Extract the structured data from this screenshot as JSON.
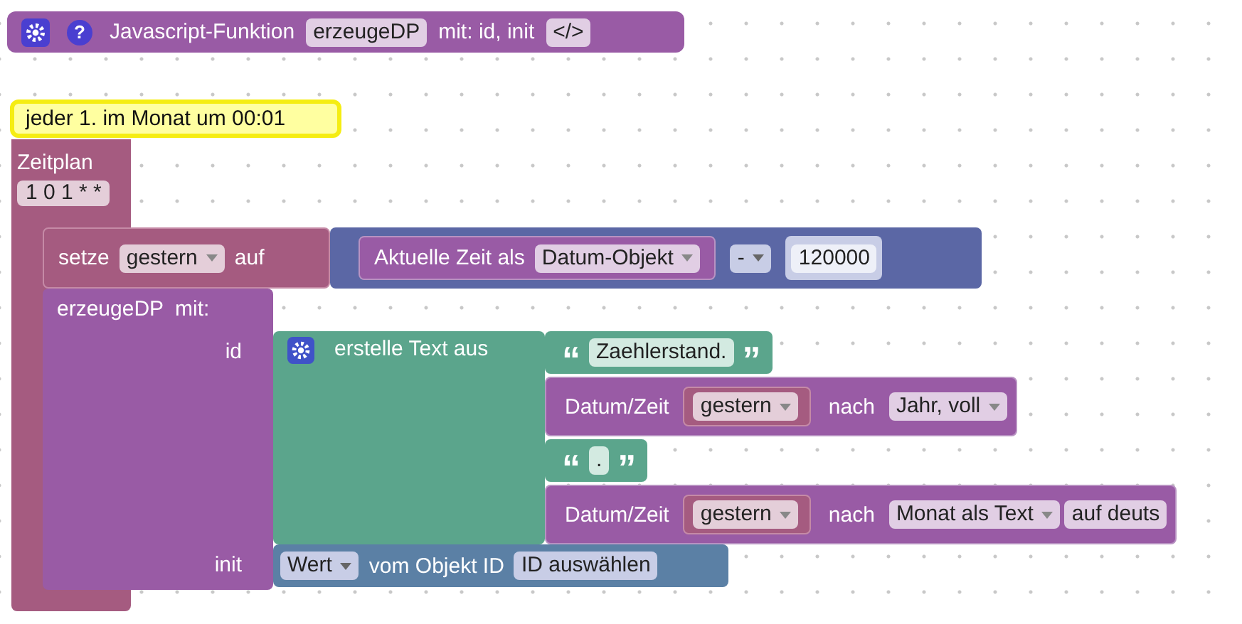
{
  "function_block": {
    "help": "?",
    "label": "Javascript-Funktion",
    "name": "erzeugeDP",
    "params": "mit: id, init",
    "code_button": "</>"
  },
  "schedule": {
    "comment": "jeder 1. im Monat um 00:01",
    "title": "Zeitplan",
    "cron": "1 0 1 * *"
  },
  "set_block": {
    "verb": "setze",
    "variable": "gestern",
    "to": "auf",
    "time_label": "Aktuelle Zeit als",
    "time_format": "Datum-Objekt",
    "operator": "-",
    "number": "120000"
  },
  "call_block": {
    "name": "erzeugeDP",
    "with": "mit:",
    "args": [
      "id",
      "init"
    ]
  },
  "text_join": {
    "label": "erstelle Text aus",
    "open_quote": "“",
    "close_quote": "”",
    "items": [
      {
        "kind": "text",
        "value": "Zaehlerstand."
      },
      {
        "kind": "date",
        "label": "Datum/Zeit",
        "variable": "gestern",
        "to": "nach",
        "format": "Jahr, voll"
      },
      {
        "kind": "text",
        "value": "."
      },
      {
        "kind": "date",
        "label": "Datum/Zeit",
        "variable": "gestern",
        "to": "nach",
        "format": "Monat als Text",
        "extra": "auf deuts"
      }
    ]
  },
  "state_block": {
    "field": "Wert",
    "label": "vom Objekt ID",
    "object": "ID auswählen"
  }
}
